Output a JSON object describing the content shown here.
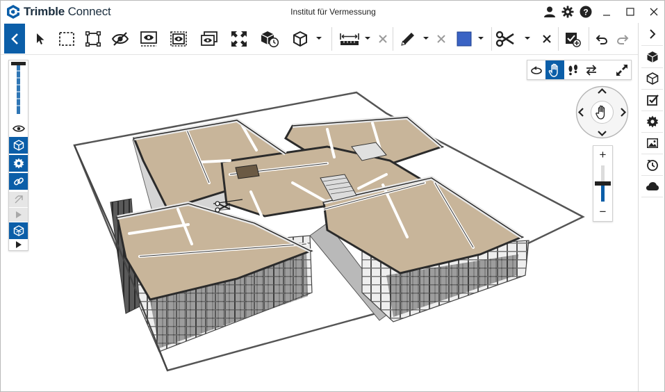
{
  "app": {
    "brand_strong": "Trimble",
    "brand_light": " Connect",
    "window_title": "Institut für Vermessung"
  },
  "colors": {
    "accent": "#0b5ea8",
    "color_swatch": "#3a63c4",
    "icon": "#222222",
    "disabled": "#9a9a9a",
    "floor": "#c8b59a"
  },
  "titlebar_icons": [
    "user-icon",
    "gear-icon",
    "help-icon",
    "minimize-icon",
    "maximize-icon",
    "close-icon"
  ],
  "toolbar": {
    "tools": [
      "collapse-left-icon",
      "select-pointer-icon",
      "box-select-icon",
      "fit-selection-icon",
      "hide-icon",
      "isolate-icon",
      "show-selected-icon",
      "show-all-icon",
      "fit-all-icon",
      "object-status-icon",
      "view-cube-icon",
      "measure-icon",
      "clear-measure-icon",
      "markup-pencil-icon",
      "clear-markup-icon",
      "color-swatch-icon",
      "section-scissors-icon",
      "clear-section-icon",
      "create-todo-icon",
      "undo-icon",
      "redo-icon"
    ]
  },
  "left_panel": {
    "buttons": [
      "visibility-eye-icon",
      "model-cube-icon",
      "settings-badge-icon",
      "link-icon",
      "laser-icon",
      "play-icon",
      "layers-icon",
      "expand-arrow-icon"
    ],
    "slider_level": 0.95
  },
  "nav_panel": {
    "buttons": [
      "orbit-icon",
      "pan-hand-icon",
      "walk-footsteps-icon",
      "swap-arrows-icon",
      "fullscreen-icon"
    ],
    "active": "pan-hand-icon"
  },
  "zoom": {
    "plus": "+",
    "minus": "−",
    "level": 0.3
  },
  "right_sidebar": {
    "buttons": [
      "expand-right-icon",
      "models-cube-icon",
      "objects-cube-icon",
      "todo-check-icon",
      "properties-badge-icon",
      "image-icon",
      "history-clock-icon",
      "cloud-icon"
    ]
  }
}
